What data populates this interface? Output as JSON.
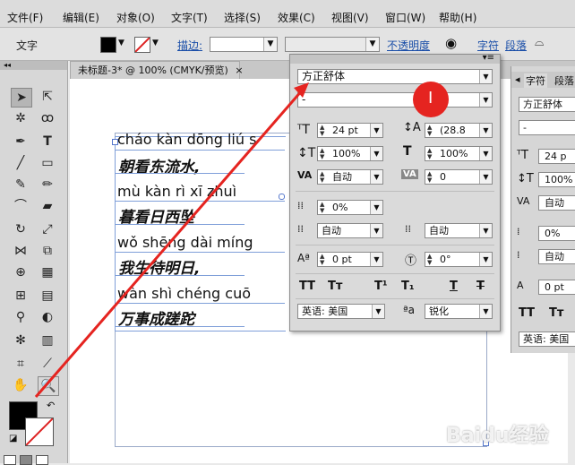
{
  "menubar": {
    "items": [
      "文件(F)",
      "编辑(E)",
      "对象(O)",
      "文字(T)",
      "选择(S)",
      "效果(C)",
      "视图(V)",
      "窗口(W)",
      "帮助(H)"
    ]
  },
  "controlbar": {
    "mode_label": "文字",
    "stroke_label": "描边:",
    "opacity_label": "不透明度",
    "char_link": "字符",
    "para_link": "段落"
  },
  "document": {
    "tab_title": "未标题-3* @ 100% (CMYK/预览)",
    "lines": [
      {
        "pinyin": "cháo kàn dōng liú s",
        "hanzi": "朝看东流水,"
      },
      {
        "pinyin": "mù kàn rì xī zhuì",
        "hanzi": "暮看日西坠"
      },
      {
        "pinyin": "wǒ shēng dài míng",
        "hanzi": "我生待明日,"
      },
      {
        "pinyin": "wàn shì chéng cuō",
        "hanzi": "万事成蹉跎"
      }
    ]
  },
  "char_panel": {
    "font_family": "方正舒体",
    "font_style": "-",
    "font_size": "24 pt",
    "leading": "(28.8",
    "vertical_scale": "100%",
    "horizontal_scale": "100%",
    "kerning": "自动",
    "tracking": "0",
    "tsume": "0%",
    "aki_left": "自动",
    "aki_right": "自动",
    "baseline_shift": "0 pt",
    "rotation": "0°",
    "style_buttons": [
      "TT",
      "Tт",
      "T¹",
      "T₁",
      "T",
      "T"
    ],
    "language": "英语: 美国",
    "antialias_icon_label": "ªa",
    "antialias": "锐化"
  },
  "right_panel": {
    "tab1": "字符",
    "tab2": "段落",
    "font_family": "方正舒体",
    "font_style": "-",
    "font_size": "24 p",
    "vertical_scale": "100%",
    "kerning": "自动",
    "tsume": "0%",
    "aki": "自动",
    "baseline_shift": "0 pt",
    "style_buttons": [
      "TT",
      "Tт"
    ],
    "language": "英语: 美国"
  },
  "watermark": "Baidu经验",
  "colors": {
    "annotation_red": "#e52420",
    "panel_bg": "#dadada",
    "guide_blue": "#7f9fd9"
  }
}
